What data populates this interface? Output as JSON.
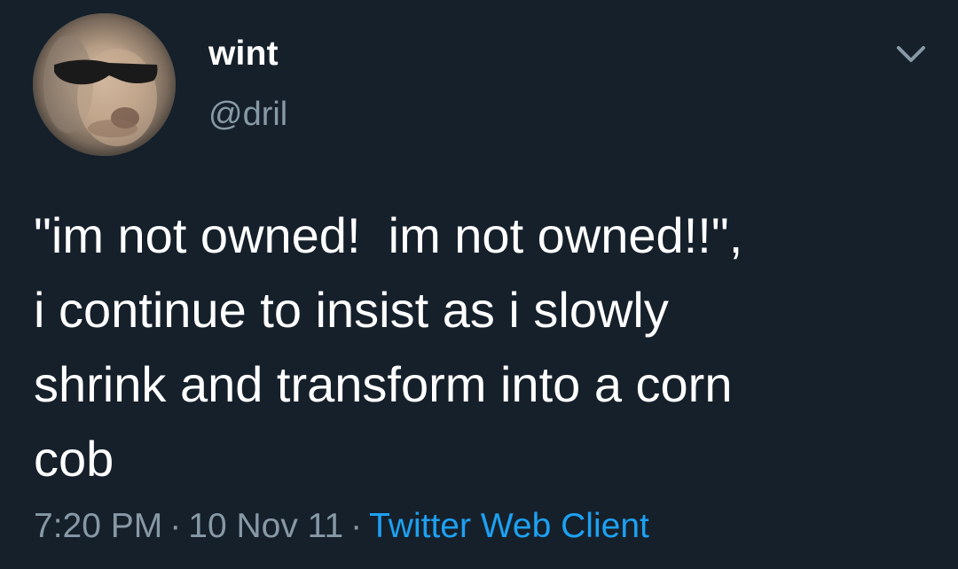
{
  "author": {
    "display_name": "wint",
    "handle": "@dril"
  },
  "tweet": {
    "text": "\"im not owned!  im not owned!!\",\ni continue to insist as i slowly\nshrink and transform into a corn\ncob",
    "time": "7:20 PM",
    "separator": "·",
    "date": "10 Nov 11",
    "source": "Twitter Web Client"
  },
  "icons": {
    "menu": "chevron-down-icon",
    "avatar": "avatar-image"
  },
  "colors": {
    "background": "#15202b",
    "text": "#ffffff",
    "secondary": "#8899a6",
    "accent": "#1da1f2"
  }
}
